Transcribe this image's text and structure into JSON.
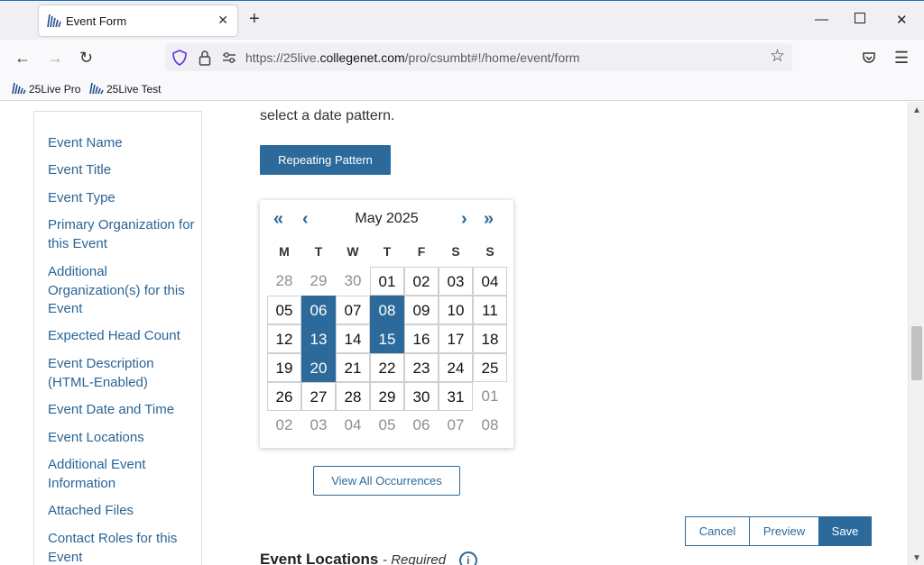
{
  "browser": {
    "tab_title": "Event Form",
    "tab_close": "✕",
    "new_tab": "+",
    "url_prefix": "https://25live.",
    "url_domain": "collegenet.com",
    "url_path": "/pro/csumbt#!/home/event/form",
    "bookmarks": [
      "25Live Pro",
      "25Live Test"
    ],
    "accent_color": "#1e6fb8"
  },
  "sidebar": {
    "items": [
      "Event Name",
      "Event Title",
      "Event Type",
      "Primary Organization for this Event",
      "Additional Organization(s) for this Event",
      "Expected Head Count",
      "Event Description (HTML-Enabled)",
      "Event Date and Time",
      "Event Locations",
      "Additional Event Information",
      "Attached Files",
      "Contact Roles for this Event"
    ]
  },
  "main": {
    "instruction_text": "select a date pattern.",
    "repeating_pattern_label": "Repeating Pattern",
    "view_all_label": "View All Occurrences",
    "section_title": "Event Locations",
    "section_required": "- Required",
    "info_icon_glyph": "i"
  },
  "calendar": {
    "month_label": "May 2025",
    "weekday_headers": [
      "M",
      "T",
      "W",
      "T",
      "F",
      "S",
      "S"
    ],
    "weeks": [
      [
        "28",
        "29",
        "30",
        "01",
        "02",
        "03",
        "04"
      ],
      [
        "05",
        "06",
        "07",
        "08",
        "09",
        "10",
        "11"
      ],
      [
        "12",
        "13",
        "14",
        "15",
        "16",
        "17",
        "18"
      ],
      [
        "19",
        "20",
        "21",
        "22",
        "23",
        "24",
        "25"
      ],
      [
        "26",
        "27",
        "28",
        "29",
        "30",
        "31",
        "01"
      ],
      [
        "02",
        "03",
        "04",
        "05",
        "06",
        "07",
        "08"
      ]
    ],
    "selected_days": [
      "06",
      "08",
      "13",
      "15",
      "20"
    ],
    "selected_color": "#2b6a9a"
  },
  "actions": {
    "cancel": "Cancel",
    "preview": "Preview",
    "save": "Save"
  }
}
